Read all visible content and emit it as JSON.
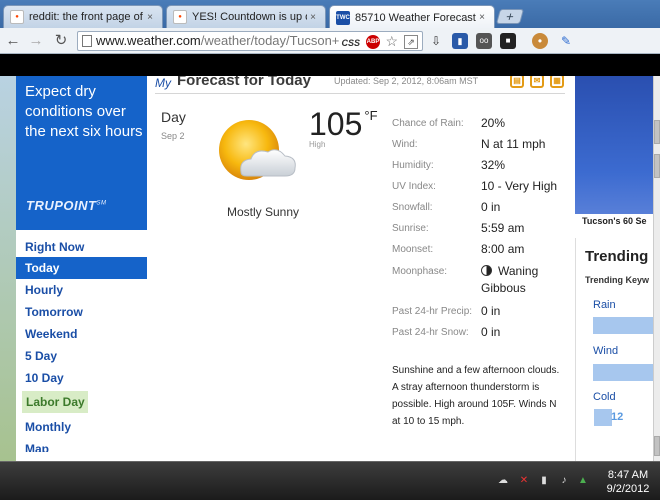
{
  "browser": {
    "tabs": [
      {
        "title": "reddit: the front page of th",
        "favicon": "reddit-alien-icon",
        "active": false
      },
      {
        "title": "YES! Countdown is up on E",
        "favicon": "reddit-alien-icon",
        "active": false
      },
      {
        "title": "85710 Weather Forecast an",
        "favicon": "twc-logo-icon",
        "favicon_text": "TWC",
        "active": true
      }
    ],
    "close_glyph": "×",
    "new_tab_glyph": "+",
    "address": {
      "host": "www.weather.com",
      "path": "/weather/today/Tucson+",
      "css_badge": "CSS",
      "abp_badge": "ABP"
    }
  },
  "promo": {
    "text": "Expect dry conditions over the next six hours",
    "logo": "TRUPOINT",
    "logo_sup": "SM"
  },
  "left_nav": {
    "items": [
      {
        "label": "Right Now",
        "selected": false
      },
      {
        "label": "Today",
        "selected": true
      },
      {
        "label": "Hourly",
        "selected": false
      },
      {
        "label": "Tomorrow",
        "selected": false
      },
      {
        "label": "Weekend",
        "selected": false
      },
      {
        "label": "5 Day",
        "selected": false
      },
      {
        "label": "10 Day",
        "selected": false
      },
      {
        "label": "Labor Day",
        "selected": false,
        "highlight": true
      },
      {
        "label": "Monthly",
        "selected": false
      },
      {
        "label": "Map",
        "selected": false
      }
    ]
  },
  "forecast": {
    "my": "My",
    "title": "Forecast for Today",
    "updated": "Updated: Sep 2, 2012, 8:06am MST",
    "period": "Day",
    "date": "Sep 2",
    "temperature": "105",
    "unit": "°F",
    "temp_label": "High",
    "condition": "Mostly Sunny",
    "details": [
      {
        "label": "Chance of Rain:",
        "value": "20%"
      },
      {
        "label": "Wind:",
        "value": "N at 11 mph"
      },
      {
        "label": "Humidity:",
        "value": "32%"
      },
      {
        "label": "UV Index:",
        "value": "10 - Very High"
      },
      {
        "label": "Snowfall:",
        "value": "0 in"
      },
      {
        "label": "Sunrise:",
        "value": "5:59 am"
      },
      {
        "label": "Moonset:",
        "value": "8:00 am"
      },
      {
        "label": "Moonphase:",
        "value": "Waning"
      },
      {
        "label": "",
        "value": "Gibbous"
      },
      {
        "label": "Past 24-hr Precip:",
        "value": "0 in"
      },
      {
        "label": "Past 24-hr Snow:",
        "value": "0 in"
      }
    ],
    "narrative": "Sunshine and a few afternoon clouds. A stray afternoon thunderstorm is possible. High around 105F. Winds N at 10 to 15 mph."
  },
  "sidebar": {
    "radar_caption": "Tucson's 60 Se",
    "trending_title": "Trending",
    "trending_sub": "Trending Keyw",
    "trends": [
      {
        "label": "Rain"
      },
      {
        "label": "Wind"
      },
      {
        "label": "Cold",
        "value": "12"
      }
    ]
  },
  "taskbar": {
    "time": "8:47 AM",
    "date": "9/2/2012"
  },
  "colors": {
    "nav_selected": "#1563c9",
    "link": "#1a4ea6",
    "accent_orange": "#e39b16"
  }
}
